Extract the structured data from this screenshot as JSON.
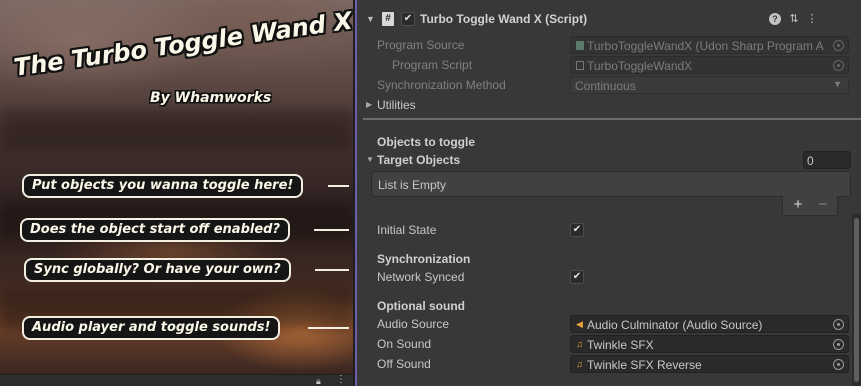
{
  "promo": {
    "title": "The Turbo Toggle Wand X",
    "byline": "By Whamworks",
    "callouts": [
      "Put objects you wanna toggle here!",
      "Does the object start off enabled?",
      "Sync globally? Or have your own?",
      "Audio player and toggle sounds!"
    ]
  },
  "component": {
    "title": "Turbo Toggle Wand X (Script)",
    "enabled": true,
    "header_icons": [
      "help-icon",
      "preset-icon",
      "menu-icon"
    ]
  },
  "fields": {
    "program_source": {
      "label": "Program Source",
      "value": "TurboToggleWandX (Udon Sharp Program A"
    },
    "program_script": {
      "label": "Program Script",
      "value": "TurboToggleWandX"
    },
    "sync_method": {
      "label": "Synchronization Method",
      "value": "Continuous"
    },
    "utilities": {
      "label": "Utilities"
    }
  },
  "objects_section": {
    "header": "Objects to toggle",
    "target_label": "Target Objects",
    "count": "0",
    "empty_text": "List is Empty",
    "add_label": "+",
    "remove_label": "−"
  },
  "initial_state": {
    "label": "Initial State",
    "checked": true
  },
  "sync_section": {
    "header": "Synchronization",
    "network_label": "Network Synced",
    "checked": true
  },
  "sound_section": {
    "header": "Optional sound",
    "audio_source": {
      "label": "Audio Source",
      "value": "Audio Culminator (Audio Source)"
    },
    "on_sound": {
      "label": "On Sound",
      "value": "Twinkle SFX"
    },
    "off_sound": {
      "label": "Off Sound",
      "value": "Twinkle SFX Reverse"
    }
  },
  "colors": {
    "inspector_bg": "#383838",
    "field_bg": "#2a2a2a",
    "accent": "#6b5fa8",
    "audio_icon": "#e8a33a"
  }
}
